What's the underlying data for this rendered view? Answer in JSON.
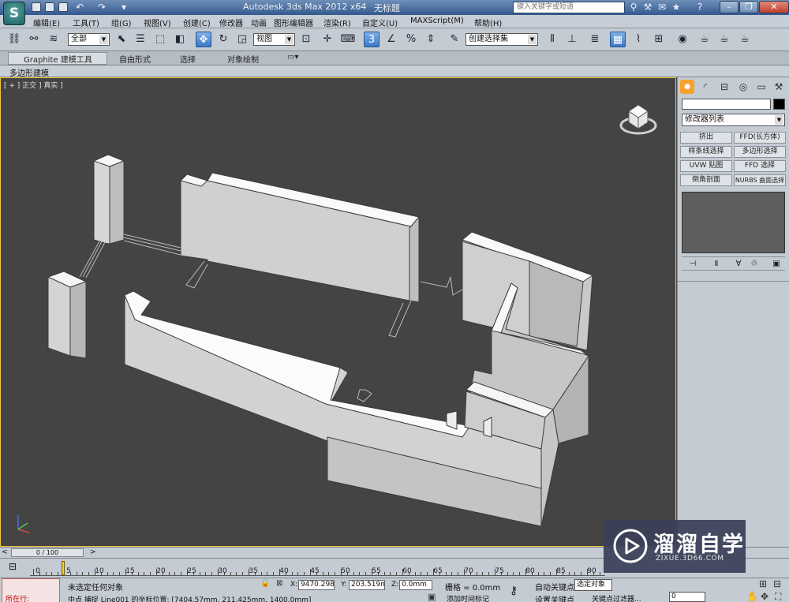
{
  "titlebar": {
    "app_title": "Autodesk 3ds Max  2012 x64",
    "doc_title": "无标题",
    "search_placeholder": "键入关键字或短语",
    "logo_letter": "S"
  },
  "menu": [
    "编辑(E)",
    "工具(T)",
    "组(G)",
    "视图(V)",
    "创建(C)",
    "修改器",
    "动画",
    "图形编辑器",
    "渲染(R)",
    "自定义(U)",
    "MAXScript(M)",
    "帮助(H)"
  ],
  "toolbar": {
    "selection_filter": "全部",
    "reference_coord": "视图",
    "named_selection": "创建选择集",
    "snap_label": "3"
  },
  "ribbon": {
    "tabs": [
      "Graphite 建模工具",
      "自由形式",
      "选择",
      "对象绘制"
    ],
    "sub_label": "多边形建模"
  },
  "viewport": {
    "label": "[ + ] 正交 ] 真实 ]"
  },
  "command_panel": {
    "modifier_list": "修改器列表",
    "buttons": [
      "挤出",
      "FFD(长方体)",
      "样条线选择",
      "多边形选择",
      "UVW 贴图",
      "FFD 选择",
      "倒角剖面",
      "NURBS 曲面选择"
    ]
  },
  "time": {
    "slider_label": "0 / 100",
    "ticks": [
      "0",
      "5",
      "10",
      "15",
      "20",
      "25",
      "30",
      "35",
      "40",
      "45",
      "50",
      "55",
      "60",
      "65",
      "70",
      "75",
      "80",
      "85",
      "90"
    ]
  },
  "status": {
    "maxscript_text": "所在行:",
    "line1": "未选定任何对象",
    "line2": "中点 捕捉 Line001 的坐标位置: [7404.57mm, 211.425mm, 1400.0mm]",
    "x_label": "X:",
    "x_value": "9470.298m",
    "y_label": "Y:",
    "y_value": "203.519mm",
    "z_label": "Z:",
    "z_value": "0.0mm",
    "grid": "栅格 = 0.0mm",
    "add_time_tag": "添加时间标记",
    "auto_key": "自动关键点",
    "set_key": "设置关键点",
    "selected": "选定对象",
    "key_filters": "关键点过滤器...",
    "frame": "0"
  },
  "watermark": {
    "title": "溜溜自学",
    "subtitle": "ZIXUE.3D66.COM"
  }
}
